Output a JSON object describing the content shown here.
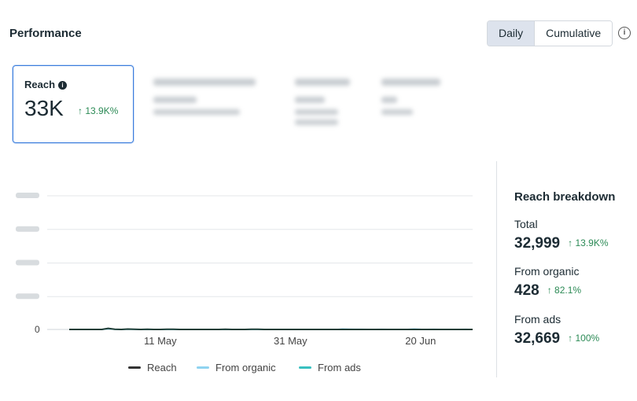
{
  "header": {
    "title": "Performance"
  },
  "toggle": {
    "daily": "Daily",
    "cumulative": "Cumulative",
    "active": "daily"
  },
  "card": {
    "label": "Reach",
    "value": "33K",
    "delta": "13.9K%"
  },
  "breakdown": {
    "title": "Reach breakdown",
    "rows": [
      {
        "label": "Total",
        "value": "32,999",
        "delta": "13.9K%"
      },
      {
        "label": "From organic",
        "value": "428",
        "delta": "82.1%"
      },
      {
        "label": "From ads",
        "value": "32,669",
        "delta": "100%"
      }
    ]
  },
  "colors": {
    "reach": "#1e3d36",
    "organic": "#8fd3f0",
    "ads": "#38c0c0",
    "positive": "#2b8a55",
    "accent": "#3b7ddd"
  },
  "chart_data": {
    "type": "line",
    "x_tick_labels": [
      "11 May",
      "31 May",
      "20 Jun"
    ],
    "x_tick_index": [
      14,
      34,
      54
    ],
    "y_tick_labels": [
      "0"
    ],
    "ylim": [
      0,
      10000
    ],
    "series": [
      {
        "name": "Reach",
        "color": "#1e3d36",
        "values": [
          0,
          0,
          0,
          0,
          0,
          0,
          80,
          20,
          0,
          30,
          20,
          0,
          20,
          0,
          0,
          10,
          10,
          0,
          0,
          0,
          0,
          0,
          0,
          0,
          10,
          0,
          0,
          0,
          10,
          10,
          0,
          0,
          0,
          0,
          0,
          0,
          0,
          0,
          0,
          0,
          0,
          0,
          0,
          0,
          0,
          0,
          0,
          0,
          0,
          0,
          0,
          0,
          0,
          0,
          0,
          0,
          0,
          0,
          0,
          0,
          0,
          0,
          0
        ]
      },
      {
        "name": "From organic",
        "color": "#8fd3f0",
        "values": [
          0,
          0,
          0,
          0,
          0,
          0,
          40,
          10,
          0,
          15,
          10,
          0,
          10,
          0,
          0,
          5,
          5,
          0,
          0,
          0,
          0,
          0,
          0,
          0,
          5,
          0,
          0,
          0,
          5,
          5,
          0,
          0,
          0,
          0,
          0,
          0,
          0,
          0,
          0,
          0,
          0,
          0,
          40,
          30,
          20,
          20,
          10,
          10,
          20,
          10,
          10,
          10,
          10,
          40,
          20,
          10,
          20,
          10,
          10,
          10,
          10,
          20,
          0
        ]
      },
      {
        "name": "From ads",
        "color": "#38c0c0",
        "values": [
          0,
          0,
          0,
          0,
          0,
          0,
          40,
          10,
          0,
          15,
          10,
          0,
          10,
          0,
          0,
          5,
          5,
          0,
          0,
          0,
          0,
          0,
          0,
          0,
          5,
          0,
          0,
          0,
          5,
          5,
          0,
          0,
          0,
          0,
          0,
          0,
          0,
          0,
          0,
          0,
          0,
          0,
          0,
          0,
          0,
          0,
          0,
          0,
          0,
          0,
          0,
          0,
          0,
          0,
          0,
          0,
          0,
          0,
          0,
          0,
          0,
          0,
          0
        ]
      }
    ]
  }
}
